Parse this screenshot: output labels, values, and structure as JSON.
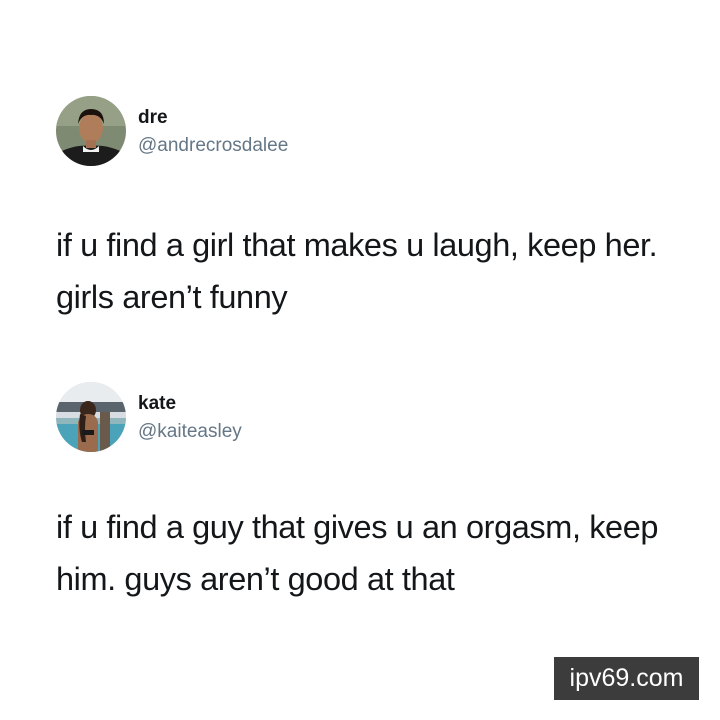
{
  "tweets": [
    {
      "author": {
        "name": "dre",
        "handle": "@andrecrosdalee"
      },
      "text": "if u find a girl that makes u laugh, keep her. girls aren’t funny"
    },
    {
      "author": {
        "name": "kate",
        "handle": "@kaiteasley"
      },
      "text": "if u find a guy that gives u an orgasm, keep him. guys aren’t good at that"
    }
  ],
  "watermark": {
    "text": "ipv69.com"
  }
}
